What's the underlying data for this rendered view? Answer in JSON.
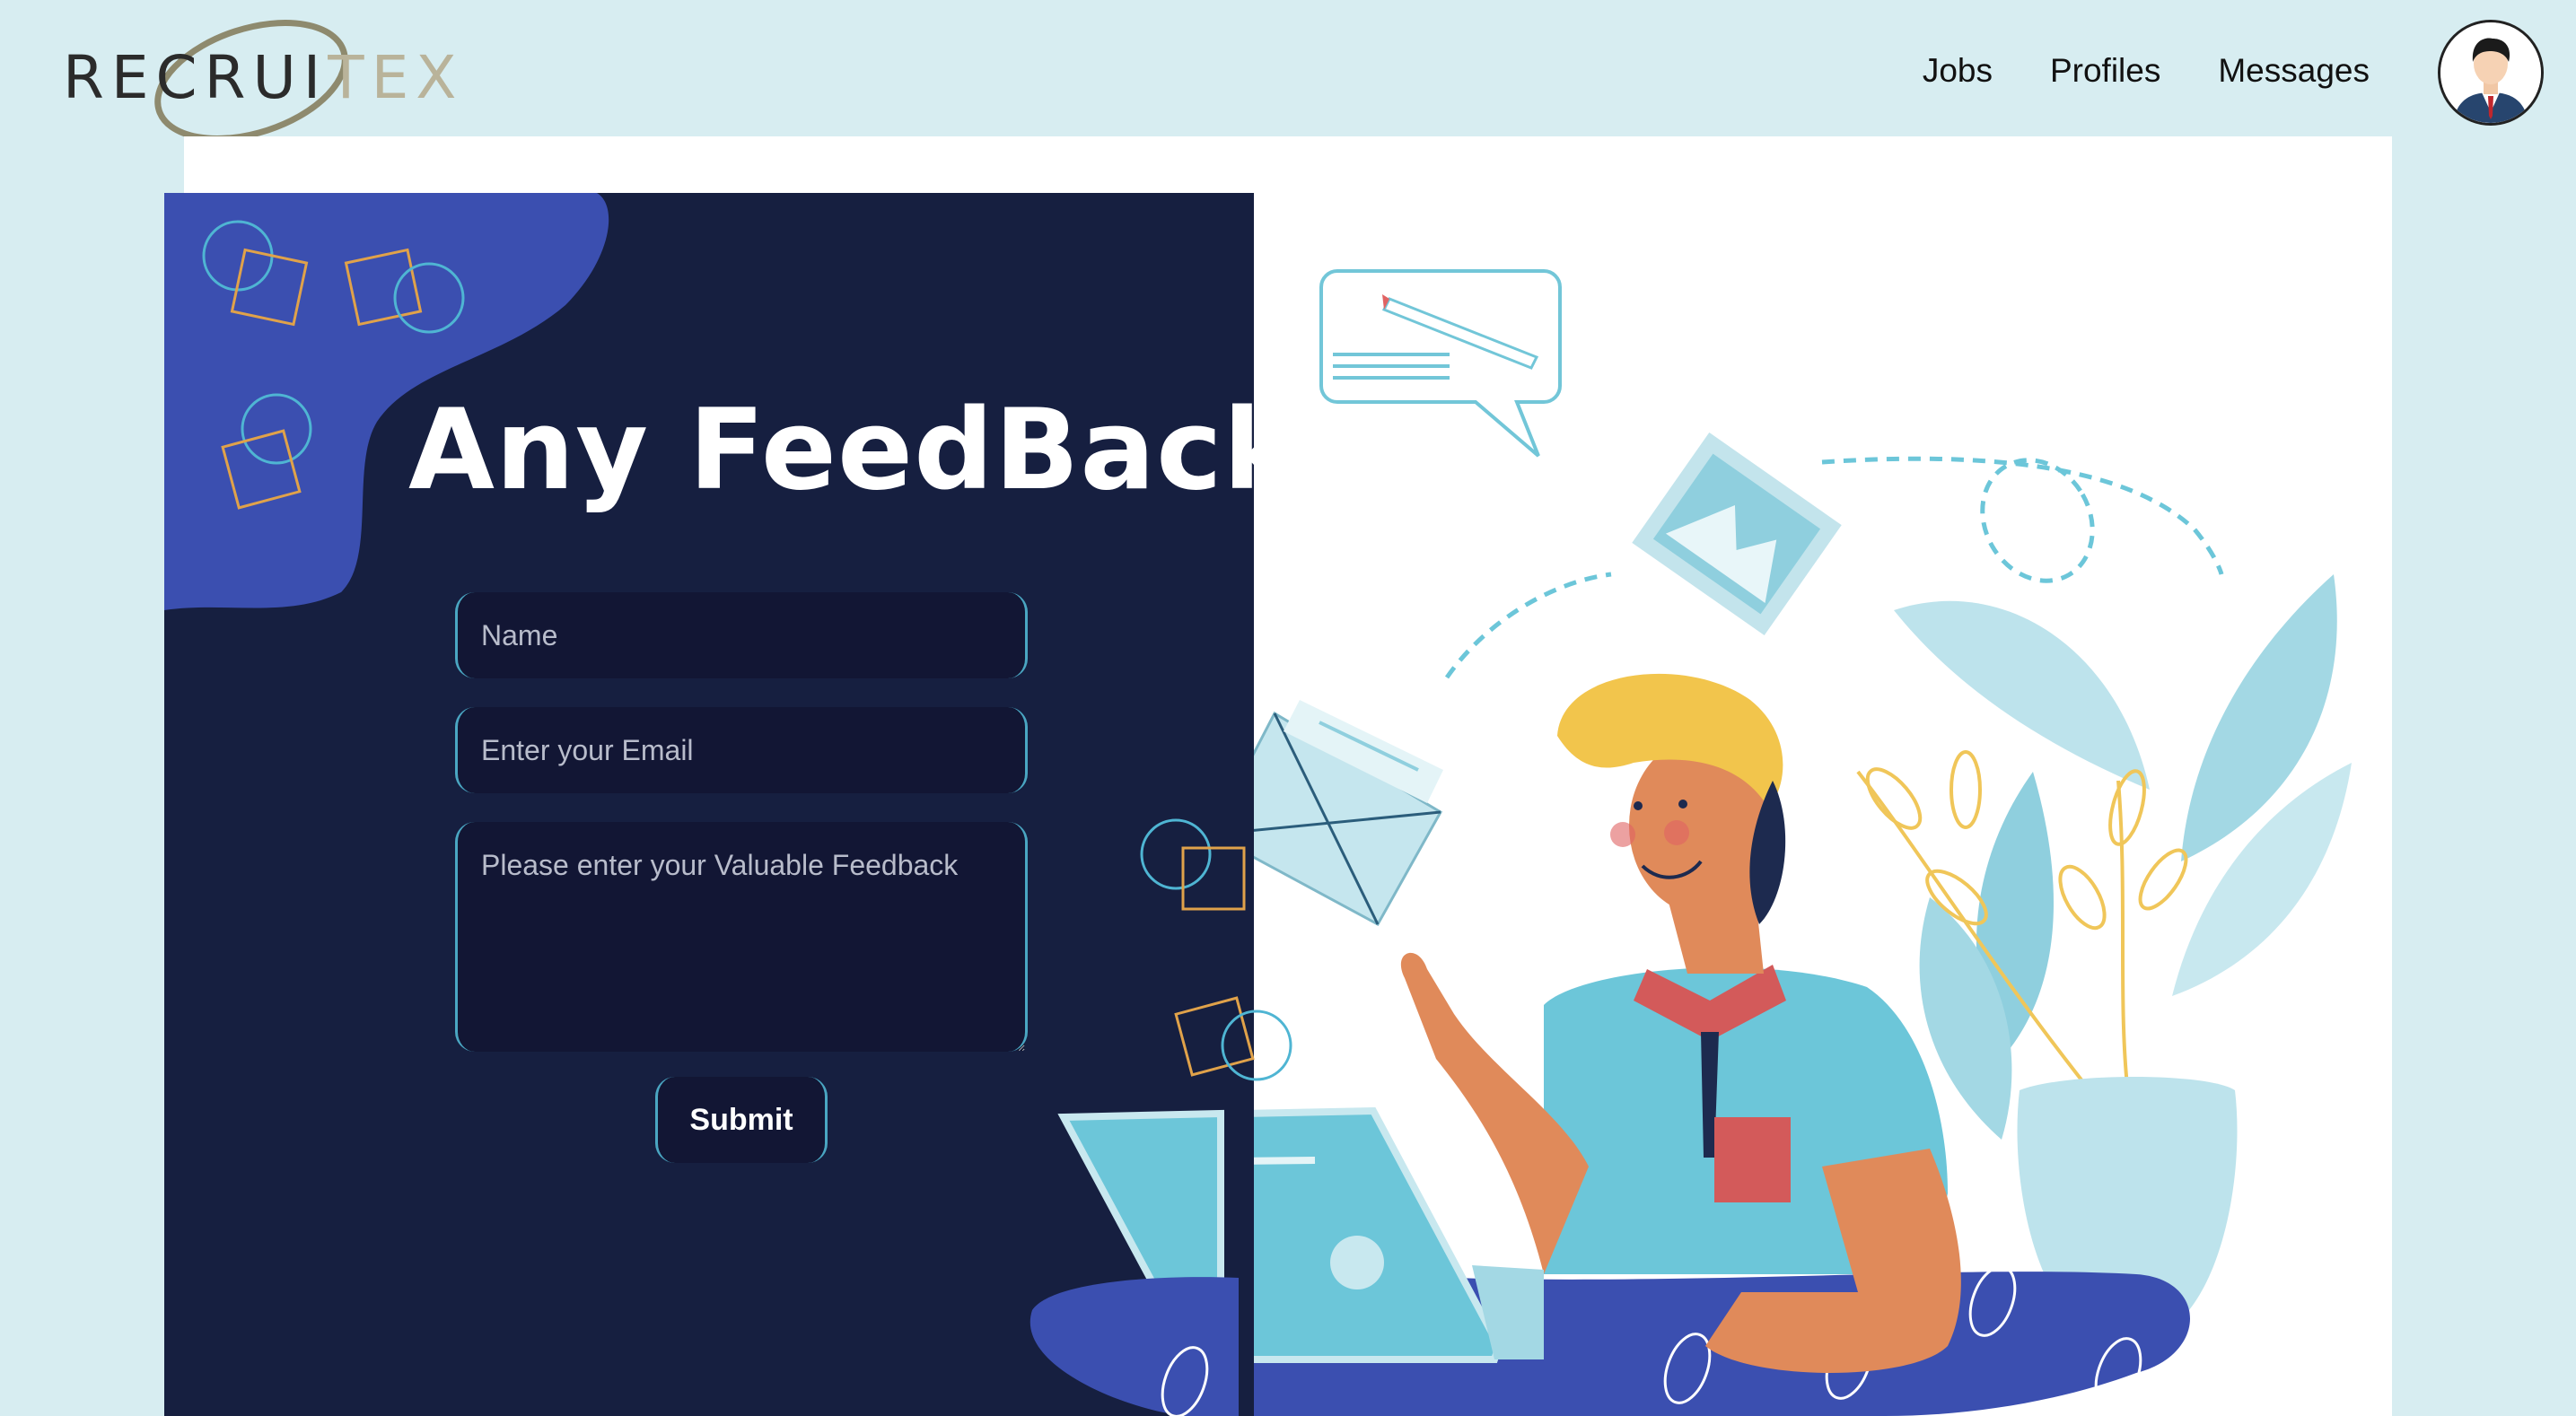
{
  "brand": {
    "logo_text": "RECRUITEX"
  },
  "nav": {
    "items": [
      {
        "label": "Jobs"
      },
      {
        "label": "Profiles"
      },
      {
        "label": "Messages"
      }
    ]
  },
  "feedback": {
    "title": "Any FeedBack",
    "name_placeholder": "Name",
    "email_placeholder": "Enter your Email",
    "feedback_placeholder": "Please enter your Valuable Feedback",
    "submit_label": "Submit"
  },
  "colors": {
    "page_bg": "#d7edf1",
    "card_bg": "#161f40",
    "accent_blue": "#3b4fb0",
    "input_border": "#4aa6c2",
    "shirt": "#6cc6d9",
    "hair": "#f2c54c"
  },
  "icons": {
    "avatar": "user-avatar-icon",
    "illustration": "person-with-laptop-illustration"
  }
}
